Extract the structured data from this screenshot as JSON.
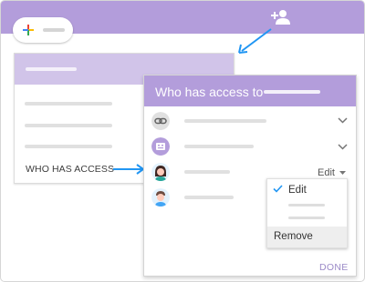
{
  "card": {
    "who_has_access": "WHO HAS ACCESS"
  },
  "dialog": {
    "title": "Who has access to",
    "permission_value": "Edit",
    "menu": {
      "edit": "Edit",
      "remove": "Remove"
    },
    "done": "DONE"
  },
  "icons": {
    "share": "person-add-icon",
    "link": "link-icon",
    "group": "group-icon",
    "chevron": "chevron-down-icon"
  },
  "colors": {
    "header": "#b39ddb",
    "card_header": "#d1c4e9",
    "accent_blue": "#2196f3"
  }
}
